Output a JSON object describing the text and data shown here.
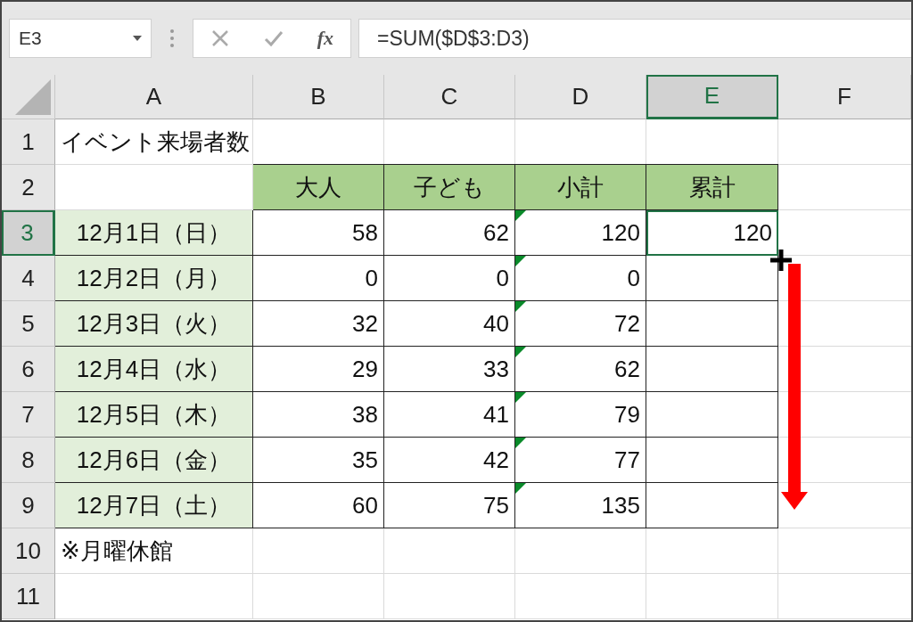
{
  "formula_bar": {
    "name_box": "E3",
    "fx": "fx",
    "formula": "=SUM($D$3:D3)"
  },
  "columns": [
    {
      "label": "A",
      "selected": false
    },
    {
      "label": "B",
      "selected": false
    },
    {
      "label": "C",
      "selected": false
    },
    {
      "label": "D",
      "selected": false
    },
    {
      "label": "E",
      "selected": true
    },
    {
      "label": "F",
      "selected": false
    }
  ],
  "rows": [
    {
      "label": "1",
      "selected": false,
      "cells": [
        {
          "kind": "text",
          "text": "イベント来場者数",
          "selected": false
        },
        {
          "kind": "empty",
          "selected": false
        },
        {
          "kind": "empty",
          "selected": false
        },
        {
          "kind": "empty",
          "selected": false
        },
        {
          "kind": "empty",
          "selected": false
        },
        {
          "kind": "empty",
          "selected": false
        }
      ]
    },
    {
      "label": "2",
      "selected": false,
      "cells": [
        {
          "kind": "empty",
          "selected": false
        },
        {
          "kind": "heading",
          "text": "大人",
          "selected": false
        },
        {
          "kind": "heading",
          "text": "子ども",
          "selected": false
        },
        {
          "kind": "heading",
          "text": "小計",
          "selected": false
        },
        {
          "kind": "heading",
          "text": "累計",
          "selected": false
        },
        {
          "kind": "empty",
          "selected": false
        }
      ]
    },
    {
      "label": "3",
      "selected": true,
      "cells": [
        {
          "kind": "date",
          "text": "12月1日（日）",
          "selected": false
        },
        {
          "kind": "number",
          "text": "58",
          "selected": false
        },
        {
          "kind": "number",
          "text": "62",
          "selected": false
        },
        {
          "kind": "flagged",
          "text": "120",
          "selected": false
        },
        {
          "kind": "number",
          "text": "120",
          "selected": true
        },
        {
          "kind": "empty",
          "selected": false
        }
      ]
    },
    {
      "label": "4",
      "selected": false,
      "cells": [
        {
          "kind": "date",
          "text": "12月2日（月）",
          "selected": false
        },
        {
          "kind": "number",
          "text": "0",
          "selected": false
        },
        {
          "kind": "number",
          "text": "0",
          "selected": false
        },
        {
          "kind": "flagged",
          "text": "0",
          "selected": false
        },
        {
          "kind": "boxed",
          "selected": false
        },
        {
          "kind": "empty",
          "selected": false
        }
      ]
    },
    {
      "label": "5",
      "selected": false,
      "cells": [
        {
          "kind": "date",
          "text": "12月3日（火）",
          "selected": false
        },
        {
          "kind": "number",
          "text": "32",
          "selected": false
        },
        {
          "kind": "number",
          "text": "40",
          "selected": false
        },
        {
          "kind": "flagged",
          "text": "72",
          "selected": false
        },
        {
          "kind": "boxed",
          "selected": false
        },
        {
          "kind": "empty",
          "selected": false
        }
      ]
    },
    {
      "label": "6",
      "selected": false,
      "cells": [
        {
          "kind": "date",
          "text": "12月4日（水）",
          "selected": false
        },
        {
          "kind": "number",
          "text": "29",
          "selected": false
        },
        {
          "kind": "number",
          "text": "33",
          "selected": false
        },
        {
          "kind": "flagged",
          "text": "62",
          "selected": false
        },
        {
          "kind": "boxed",
          "selected": false
        },
        {
          "kind": "empty",
          "selected": false
        }
      ]
    },
    {
      "label": "7",
      "selected": false,
      "cells": [
        {
          "kind": "date",
          "text": "12月5日（木）",
          "selected": false
        },
        {
          "kind": "number",
          "text": "38",
          "selected": false
        },
        {
          "kind": "number",
          "text": "41",
          "selected": false
        },
        {
          "kind": "flagged",
          "text": "79",
          "selected": false
        },
        {
          "kind": "boxed",
          "selected": false
        },
        {
          "kind": "empty",
          "selected": false
        }
      ]
    },
    {
      "label": "8",
      "selected": false,
      "cells": [
        {
          "kind": "date",
          "text": "12月6日（金）",
          "selected": false
        },
        {
          "kind": "number",
          "text": "35",
          "selected": false
        },
        {
          "kind": "number",
          "text": "42",
          "selected": false
        },
        {
          "kind": "flagged",
          "text": "77",
          "selected": false
        },
        {
          "kind": "boxed",
          "selected": false
        },
        {
          "kind": "empty",
          "selected": false
        }
      ]
    },
    {
      "label": "9",
      "selected": false,
      "cells": [
        {
          "kind": "date",
          "text": "12月7日（土）",
          "selected": false
        },
        {
          "kind": "number",
          "text": "60",
          "selected": false
        },
        {
          "kind": "number",
          "text": "75",
          "selected": false
        },
        {
          "kind": "flagged",
          "text": "135",
          "selected": false
        },
        {
          "kind": "boxed",
          "selected": false
        },
        {
          "kind": "empty",
          "selected": false
        }
      ]
    },
    {
      "label": "10",
      "selected": false,
      "cells": [
        {
          "kind": "text",
          "text": "※月曜休館",
          "selected": false
        },
        {
          "kind": "empty",
          "selected": false
        },
        {
          "kind": "empty",
          "selected": false
        },
        {
          "kind": "empty",
          "selected": false
        },
        {
          "kind": "empty",
          "selected": false
        },
        {
          "kind": "empty",
          "selected": false
        }
      ]
    },
    {
      "label": "11",
      "selected": false,
      "cells": [
        {
          "kind": "empty",
          "selected": false
        },
        {
          "kind": "empty",
          "selected": false
        },
        {
          "kind": "empty",
          "selected": false
        },
        {
          "kind": "empty",
          "selected": false
        },
        {
          "kind": "empty",
          "selected": false
        },
        {
          "kind": "empty",
          "selected": false
        }
      ]
    }
  ]
}
